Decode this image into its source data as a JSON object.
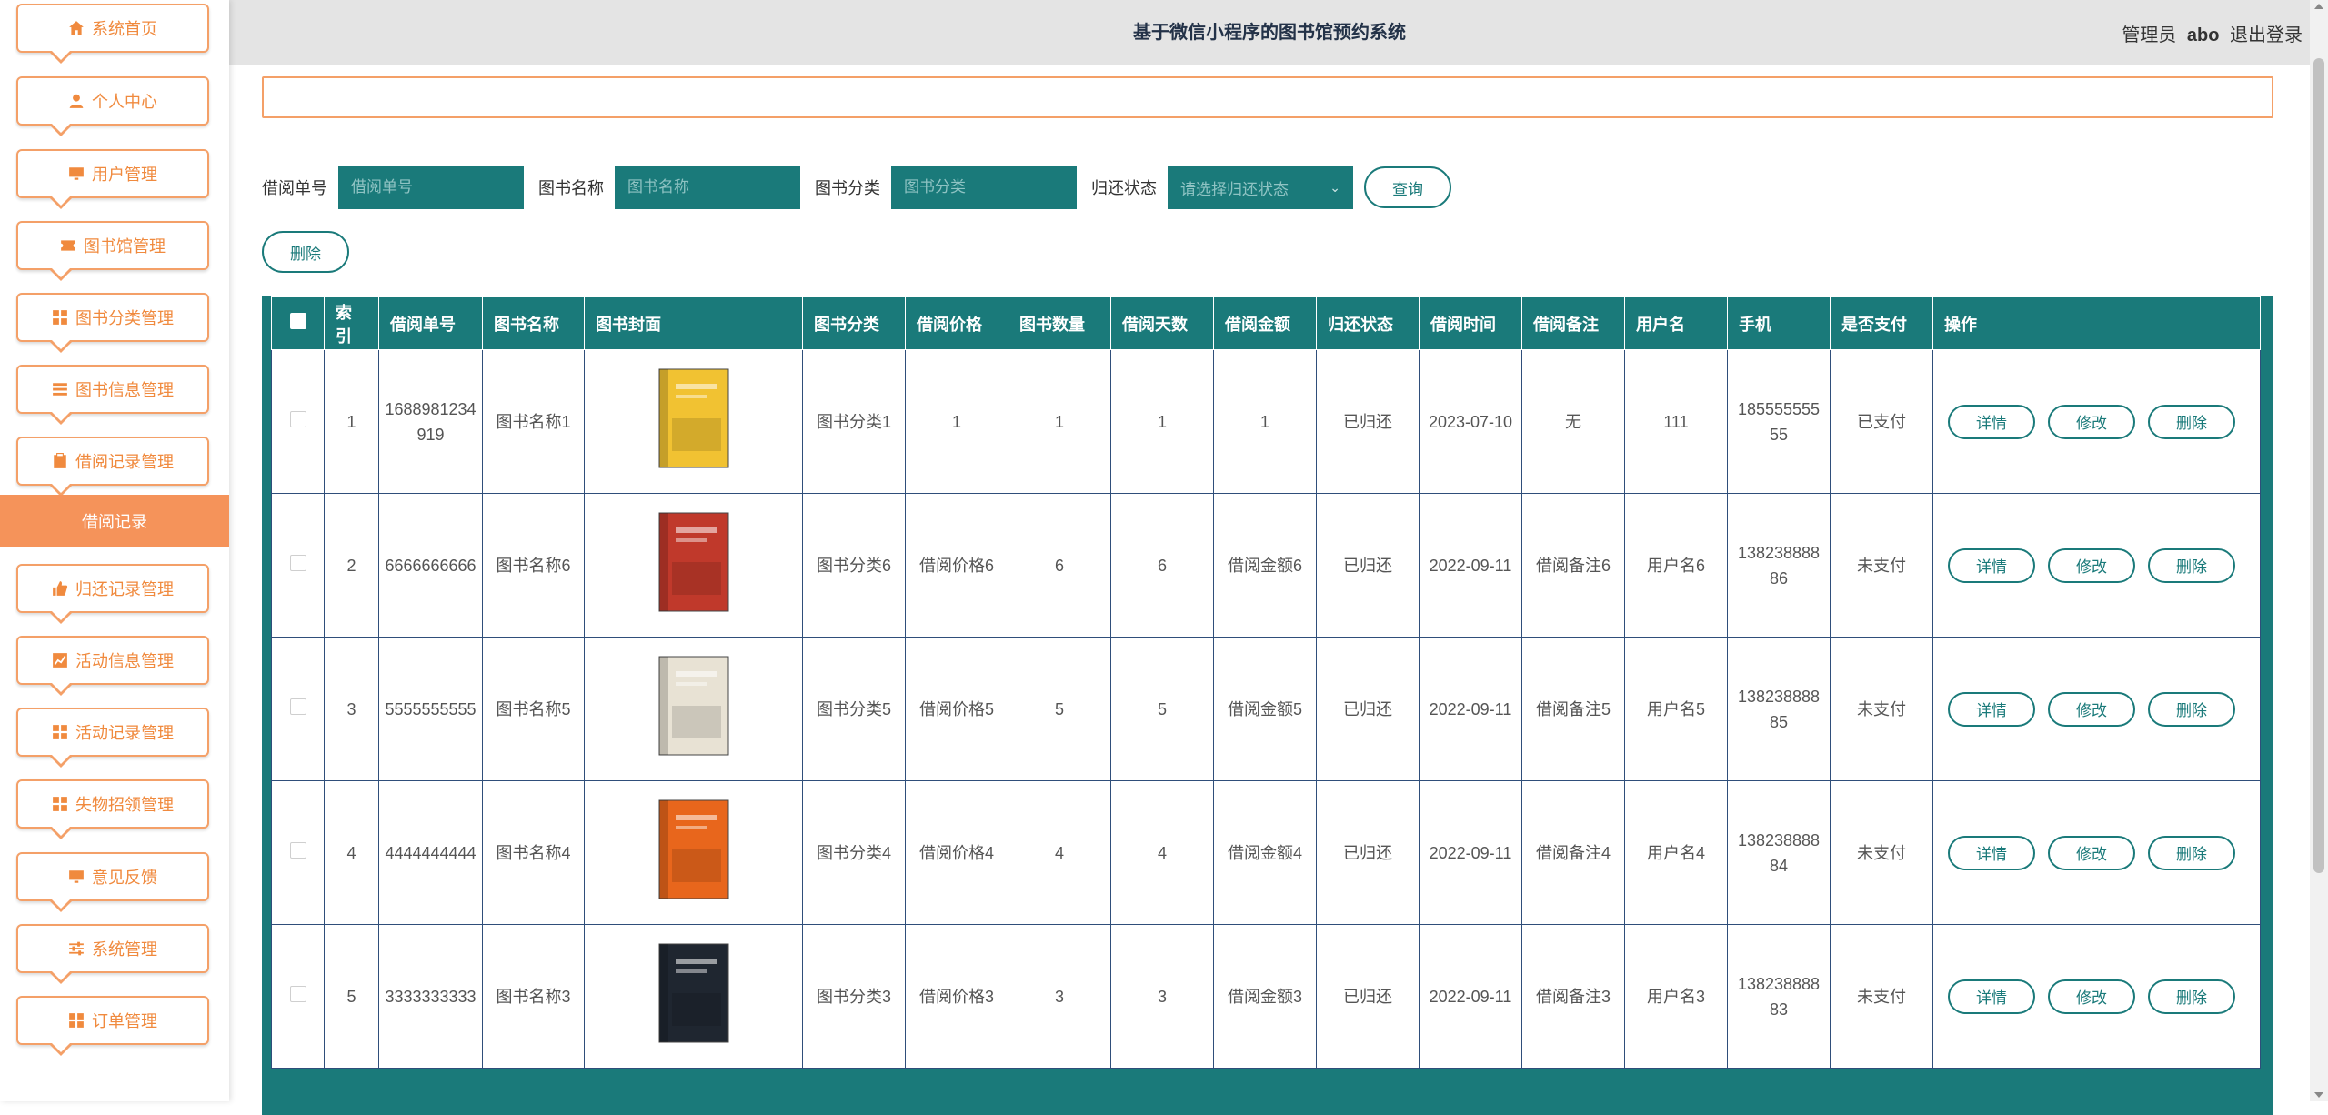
{
  "header": {
    "title": "基于微信小程序的图书馆预约系统",
    "role": "管理员",
    "username": "abo",
    "logout": "退出登录"
  },
  "sidebar": {
    "items": [
      {
        "label": "系统首页",
        "icon": "home-icon"
      },
      {
        "label": "个人中心",
        "icon": "person-icon"
      },
      {
        "label": "用户管理",
        "icon": "monitor-icon"
      },
      {
        "label": "图书馆管理",
        "icon": "ticket-icon"
      },
      {
        "label": "图书分类管理",
        "icon": "grid-icon"
      },
      {
        "label": "图书信息管理",
        "icon": "list-icon"
      },
      {
        "label": "借阅记录管理",
        "icon": "clipboard-icon"
      },
      {
        "label": "归还记录管理",
        "icon": "thumb-icon"
      },
      {
        "label": "活动信息管理",
        "icon": "chart-icon"
      },
      {
        "label": "活动记录管理",
        "icon": "grid-icon"
      },
      {
        "label": "失物招领管理",
        "icon": "grid-icon"
      },
      {
        "label": "意见反馈",
        "icon": "monitor-icon"
      },
      {
        "label": "系统管理",
        "icon": "sliders-icon"
      },
      {
        "label": "订单管理",
        "icon": "grid-icon"
      }
    ],
    "active_sub": "借阅记录"
  },
  "search": {
    "borrow_no_label": "借阅单号",
    "borrow_no_placeholder": "借阅单号",
    "book_name_label": "图书名称",
    "book_name_placeholder": "图书名称",
    "category_label": "图书分类",
    "category_placeholder": "图书分类",
    "status_label": "归还状态",
    "status_placeholder": "请选择归还状态",
    "query_button": "查询"
  },
  "toolbar": {
    "delete_label": "删除"
  },
  "table": {
    "columns": [
      "索引",
      "借阅单号",
      "图书名称",
      "图书封面",
      "图书分类",
      "借阅价格",
      "图书数量",
      "借阅天数",
      "借阅金额",
      "归还状态",
      "借阅时间",
      "借阅备注",
      "用户名",
      "手机",
      "是否支付",
      "操作"
    ],
    "actions": {
      "detail": "详情",
      "edit": "修改",
      "delete": "删除"
    },
    "rows": [
      {
        "index": "1",
        "no": "1688981234919",
        "name": "图书名称1",
        "category": "图书分类1",
        "price": "1",
        "qty": "1",
        "days": "1",
        "amount": "1",
        "status": "已归还",
        "time": "2023-07-10",
        "note": "无",
        "user": "111",
        "phone": "18555555555",
        "paid": "已支付",
        "cover_color": "#f1c232"
      },
      {
        "index": "2",
        "no": "6666666666",
        "name": "图书名称6",
        "category": "图书分类6",
        "price": "借阅价格6",
        "qty": "6",
        "days": "6",
        "amount": "借阅金额6",
        "status": "已归还",
        "time": "2022-09-11",
        "note": "借阅备注6",
        "user": "用户名6",
        "phone": "13823888886",
        "paid": "未支付",
        "cover_color": "#c0392b"
      },
      {
        "index": "3",
        "no": "5555555555",
        "name": "图书名称5",
        "category": "图书分类5",
        "price": "借阅价格5",
        "qty": "5",
        "days": "5",
        "amount": "借阅金额5",
        "status": "已归还",
        "time": "2022-09-11",
        "note": "借阅备注5",
        "user": "用户名5",
        "phone": "13823888885",
        "paid": "未支付",
        "cover_color": "#e8e2d4"
      },
      {
        "index": "4",
        "no": "4444444444",
        "name": "图书名称4",
        "category": "图书分类4",
        "price": "借阅价格4",
        "qty": "4",
        "days": "4",
        "amount": "借阅金额4",
        "status": "已归还",
        "time": "2022-09-11",
        "note": "借阅备注4",
        "user": "用户名4",
        "phone": "13823888884",
        "paid": "未支付",
        "cover_color": "#e8661c"
      },
      {
        "index": "5",
        "no": "3333333333",
        "name": "图书名称3",
        "category": "图书分类3",
        "price": "借阅价格3",
        "qty": "3",
        "days": "3",
        "amount": "借阅金额3",
        "status": "已归还",
        "time": "2022-09-11",
        "note": "借阅备注3",
        "user": "用户名3",
        "phone": "13823888883",
        "paid": "未支付",
        "cover_color": "#1f2630"
      }
    ]
  }
}
